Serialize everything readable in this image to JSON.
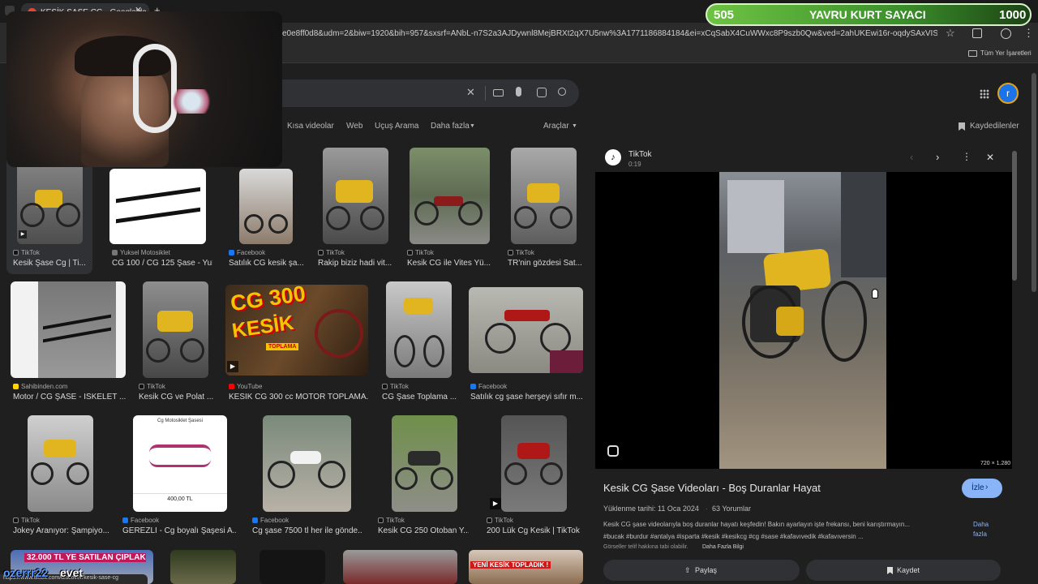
{
  "browser": {
    "tab_title": "KESİK ŞASE CG - Google'da Ara",
    "new_tab_symbol": "+",
    "url": "e0e8ff0d8&udm=2&biw=1920&bih=957&sxsrf=ANbL-n7S2a3AJDywnl8MejBRXt2qX7U5nw%3A1771186884184&ei=xCqSabX4CuWWxc8P9szb0Qw&ved=2ahUKEwi16r-oqdySAxVIS_EDHXbmNso...",
    "bookmarks_label": "Tüm Yer İşaretleri",
    "status_url": "https://www.tiktok.com/discover/kesik-sase-cg"
  },
  "google": {
    "nav": [
      "Kısa videolar",
      "Web",
      "Uçuş Arama",
      "Daha fazla",
      "Araçlar"
    ],
    "saved_label": "Kaydedilenler",
    "avatar_letter": "r"
  },
  "results": [
    {
      "source": "TikTok",
      "caption": "Kesik Şase Cg | Ti..."
    },
    {
      "source": "Yuksel Motosiklet",
      "caption": "CG 100 / CG 125 Şase - Yuks..."
    },
    {
      "source": "Facebook",
      "caption": "Satılık CG kesik şa..."
    },
    {
      "source": "TikTok",
      "caption": "Rakip biziz hadi vit..."
    },
    {
      "source": "TikTok",
      "caption": "Kesik CG ile Vites Yü..."
    },
    {
      "source": "TikTok",
      "caption": "TR'nin gözdesi Sat..."
    },
    {
      "source": "Sahibinden.com",
      "caption": "Motor / CG ŞASE - İSKELET ..."
    },
    {
      "source": "TikTok",
      "caption": "Kesik CG ve Polat ..."
    },
    {
      "source": "YouTube",
      "caption": "KESİK CG 300 cc MOTOR TOPLAMA..."
    },
    {
      "source": "TikTok",
      "caption": "CG Şase Toplama ..."
    },
    {
      "source": "Facebook",
      "caption": "Satılık cg şase herşeyi sıfır m..."
    },
    {
      "source": "TikTok",
      "caption": "Jokey Aranıyor: Şampiyo..."
    },
    {
      "source": "Facebook",
      "caption": "GEREZLİ - Cg boyalı Şaşesi A..."
    },
    {
      "source": "Facebook",
      "caption": "Cg şase 7500 tl her ile gönde..."
    },
    {
      "source": "TikTok",
      "caption": "Kesik CG 250 Otoban Y..."
    },
    {
      "source": "TikTok",
      "caption": "200 Lük Cg Kesik | TikTok"
    }
  ],
  "thumb_text": {
    "cg300_line1": "CG 300",
    "cg300_line2": "KESİK",
    "cg300_sub": "TOPLAMA",
    "catalog_title": "Cg Motosiklet Şasesi",
    "catalog_price": "400,00 TL",
    "bottom_banner": "YENİ KESİK TOPLADIK !"
  },
  "panel": {
    "source": "TikTok",
    "duration": "0:19",
    "dimensions": "720 × 1.280",
    "title": "Kesik CG Şase Videoları - Boş Duranlar Hayat",
    "visit_label": "İzle",
    "upload_date": "Yüklenme tarihi: 11 Oca 2024",
    "comments": "63 Yorumlar",
    "desc_line1": "Kesik CG şase videolarıyla boş duranlar hayatı keşfedin! Bakın ayarlayın işte frekansı, beni karıştırmayın...",
    "desc_line2": "#bucak #burdur #antalya #isparta #kesik #kesikcg #cg #sase #kafavıvedik #kafavıversin ...",
    "more_label": "Daha fazla",
    "copyright": "Görseller telif hakkına tabi olabilir.",
    "more_info": "Daha Fazla Bilgi",
    "share_label": "Paylaş",
    "save_label": "Kaydet"
  },
  "overlay": {
    "counter_left": "505",
    "counter_title": "YAVRU KURT SAYACI",
    "counter_right": "1000",
    "chat_user": "ozerrr22",
    "chat_msg": "evet",
    "banner_text": "32.000 TL YE SATILAN ÇIPLAK MOTOSİKLET !"
  },
  "colors": {
    "accent_blue": "#8ab4f8",
    "counter_green": "#5fb33a",
    "moto_yellow": "#e1b520"
  }
}
